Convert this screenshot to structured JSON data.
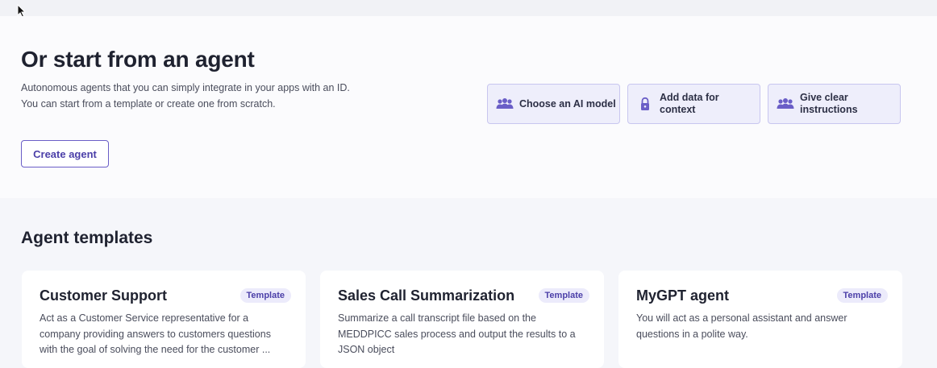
{
  "hero": {
    "title": "Or start from an agent",
    "description_lines": [
      "Autonomous agents that you can simply integrate in your apps with an ID.",
      "You can start from a template or create one from scratch."
    ],
    "create_button_label": "Create agent",
    "features": [
      {
        "label_lines": [
          "Choose an AI model"
        ],
        "icon": "users-icon"
      },
      {
        "label_lines": [
          "Add data for",
          "context"
        ],
        "icon": "lock-icon"
      },
      {
        "label_lines": [
          "Give clear",
          "instructions"
        ],
        "icon": "users-icon"
      }
    ]
  },
  "templates": {
    "section_title": "Agent templates",
    "cards": [
      {
        "title": "Customer Support",
        "badge": "Template",
        "description_lines": [
          "Act as a Customer Service representative for a",
          "company providing answers to customers questions",
          "with the goal of solving the need for the customer ..."
        ]
      },
      {
        "title": "Sales Call Summarization",
        "badge": "Template",
        "description_lines": [
          "Summarize a call transcript file based on the",
          "MEDDPICC sales process and output the results to a",
          "JSON object"
        ]
      },
      {
        "title": "MyGPT agent",
        "badge": "Template",
        "description_lines": [
          "You will act as a personal assistant and answer",
          "questions in a polite way."
        ]
      }
    ]
  },
  "colors": {
    "accent": "#6a5ec7",
    "feature_bg": "#eeeefb",
    "page_bg": "#f5f6fa"
  }
}
